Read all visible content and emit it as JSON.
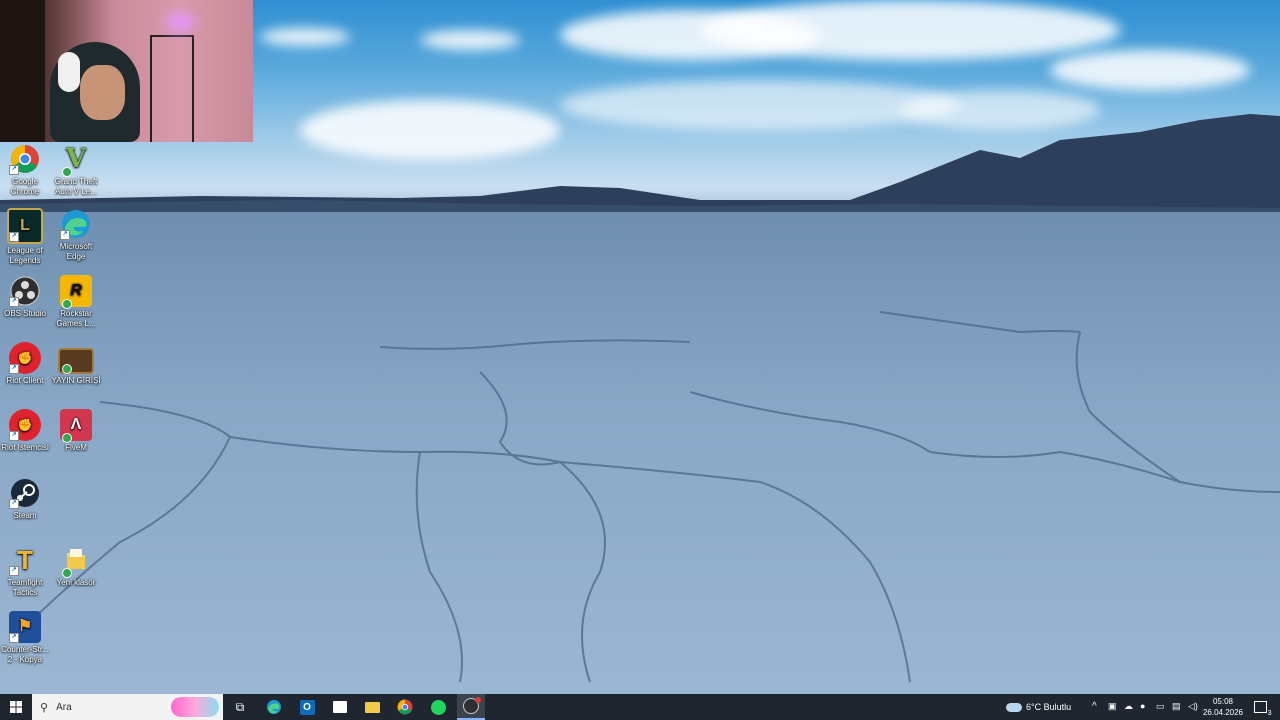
{
  "desktop_icons": [
    {
      "label": "Google Chrome"
    },
    {
      "label": "Grand Theft Auto V Le..."
    },
    {
      "label": "League of Legends"
    },
    {
      "label": "Microsoft Edge"
    },
    {
      "label": "OBS Studio"
    },
    {
      "label": "Rockstar Games L..."
    },
    {
      "label": "Riot Client"
    },
    {
      "label": "YAYIN GİRİŞİ"
    },
    {
      "label": "Riot İstemcisi"
    },
    {
      "label": "FiveM"
    },
    {
      "label": "Steam"
    },
    {
      "label": "Teamfight Tactics"
    },
    {
      "label": "Yeni klasör"
    },
    {
      "label": "Counter-Str... 2 - Kopya"
    }
  ],
  "taskbar": {
    "search_placeholder": "Ara",
    "weather": "6°C  Bulutlu",
    "time": "05:08",
    "date": "26.04.2026",
    "notification_count": "3"
  }
}
